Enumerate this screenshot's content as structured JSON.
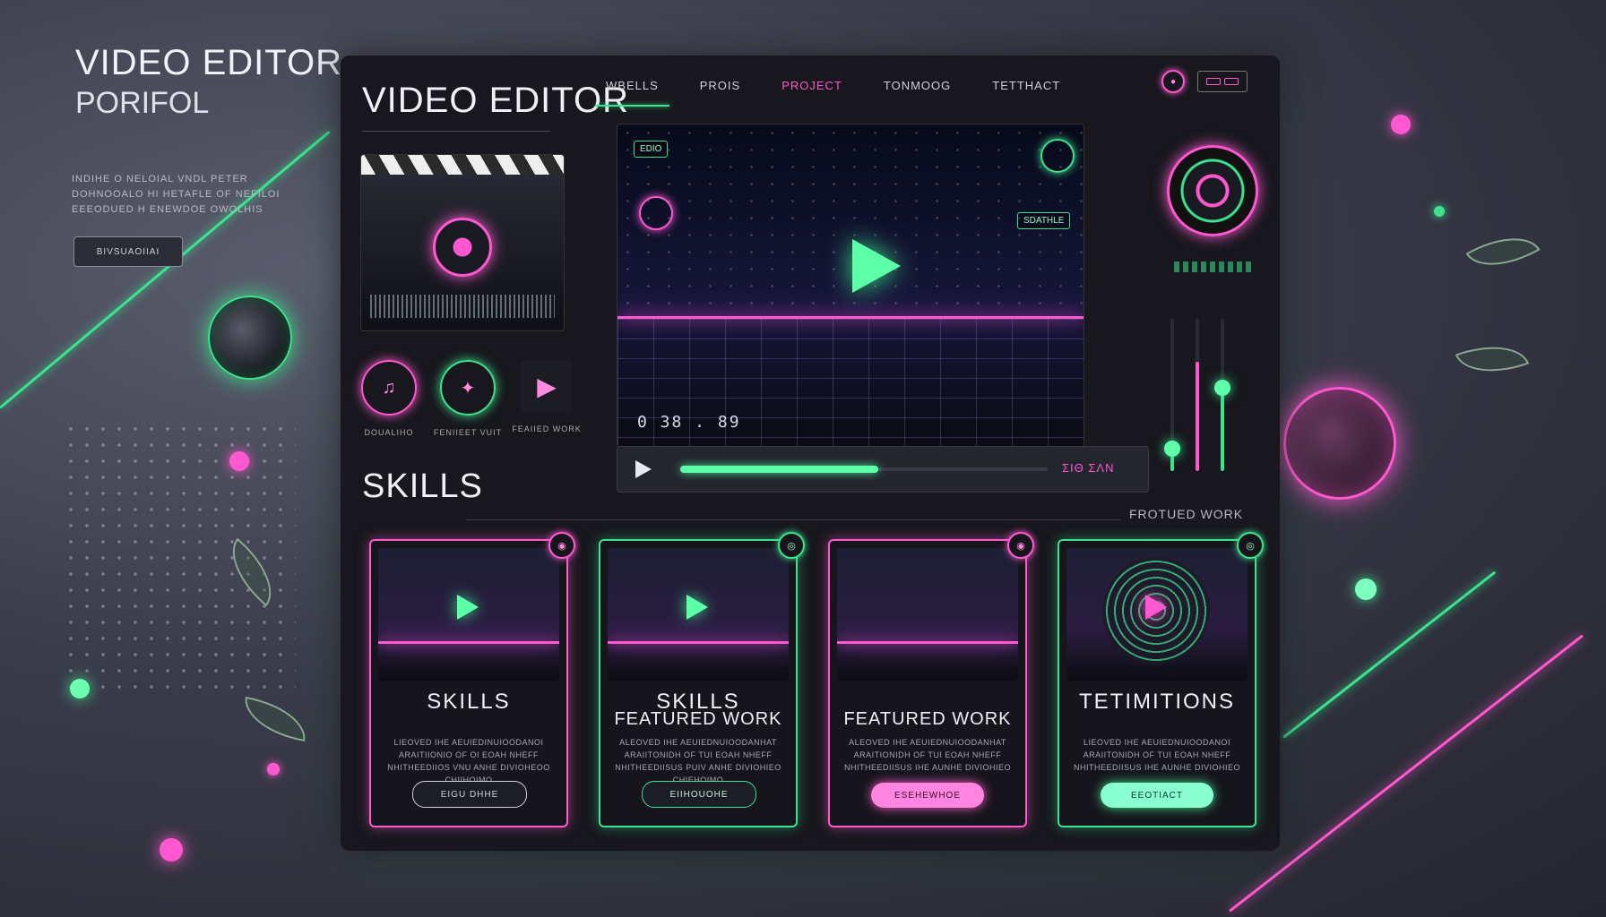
{
  "hero": {
    "title": "VIDEO EDITOR",
    "subtitle": "PORIFOL",
    "text": "INDIHE O NELOIAL VNDL PETER DOHNOOALO HI HETAFLE OF NEFILOI EEEODUED H ENEWDOE OWOLHIS",
    "button_label": "BIVSUAOIIAI"
  },
  "panel": {
    "logo": "VIDEO EDITOR",
    "nav": [
      {
        "label": "WBELLS",
        "active": false
      },
      {
        "label": "PROIS",
        "active": false
      },
      {
        "label": "PROJECT",
        "active": true
      },
      {
        "label": "TONMOOG",
        "active": false
      },
      {
        "label": "TETTHACT",
        "active": false
      }
    ],
    "mini_tools": [
      {
        "icon": "music-icon",
        "glyph": "♫",
        "label": "DOUALIHO"
      },
      {
        "icon": "wand-icon",
        "glyph": "✦",
        "label": "FENIIEET VUIT"
      },
      {
        "icon": "image-icon",
        "glyph": "▶",
        "label": "FEAIIED WORK"
      }
    ],
    "player": {
      "timecode": "0 38 . 89",
      "hud_top_left": "EDIO",
      "hud_right": "SDATHLE",
      "volume_label": "ΣΙΘ ΣΛΝ",
      "progress": 0.54
    },
    "sliders": [
      {
        "level": 0.15
      },
      {
        "level": 0.72
      },
      {
        "level": 0.55
      }
    ],
    "skills_heading": "SKILLS",
    "featured_label": "FROTUED WORK",
    "cards": [
      {
        "style": "pink",
        "title": "SKILLS",
        "title2": "",
        "desc": "LIEOVED IHE AEUIEDINUIOODANOI ARAITIIONIO OF OI EOAH NHEFF NHITHEEDIIOS VNU ANHE DIVIOHEOO CHIIHOIMO",
        "button": "EIGU DHHE",
        "button_style": "outline-white",
        "badge": "◉"
      },
      {
        "style": "green",
        "title": "SKILLS",
        "title2": "FEATURED WORK",
        "desc": "ALEOVED IHE AEUIEDNUIOODANHAT ARAIITONIDH OF TUI EOAH NHEFF NHITHEEDIISUS PUIV ANHE DIVIOHIEO CHIEHOIMO",
        "button": "EIIHOUOHE",
        "button_style": "outline-green",
        "badge": "◎"
      },
      {
        "style": "pink",
        "title": "",
        "title2": "FEATURED WORK",
        "desc": "ALEOVED IHE AEUIEDNUIOODANHAT ARAITIONIDH OF TUI EOAH NHEFF NHITHEEDIISUS IHE AUNHE DIVIOHIEO",
        "button": "ESEHEWHOE",
        "button_style": "solid-pink",
        "badge": "◉"
      },
      {
        "style": "green",
        "title": "TETIMITIONS",
        "title2": "",
        "desc": "LIEOVED IHE AEUIEDNUIOODANOI ARAIITONIDH OF TUI EOAH NHEFF NHITHEEDIISUS IHE AUNHE DIVIOHIEO",
        "button": "EEOTIACT",
        "button_style": "solid-mint",
        "badge": "◎"
      }
    ]
  },
  "colors": {
    "neon_pink": "#ff58d0",
    "neon_green": "#3de28e",
    "panel_bg": "#17171d"
  }
}
